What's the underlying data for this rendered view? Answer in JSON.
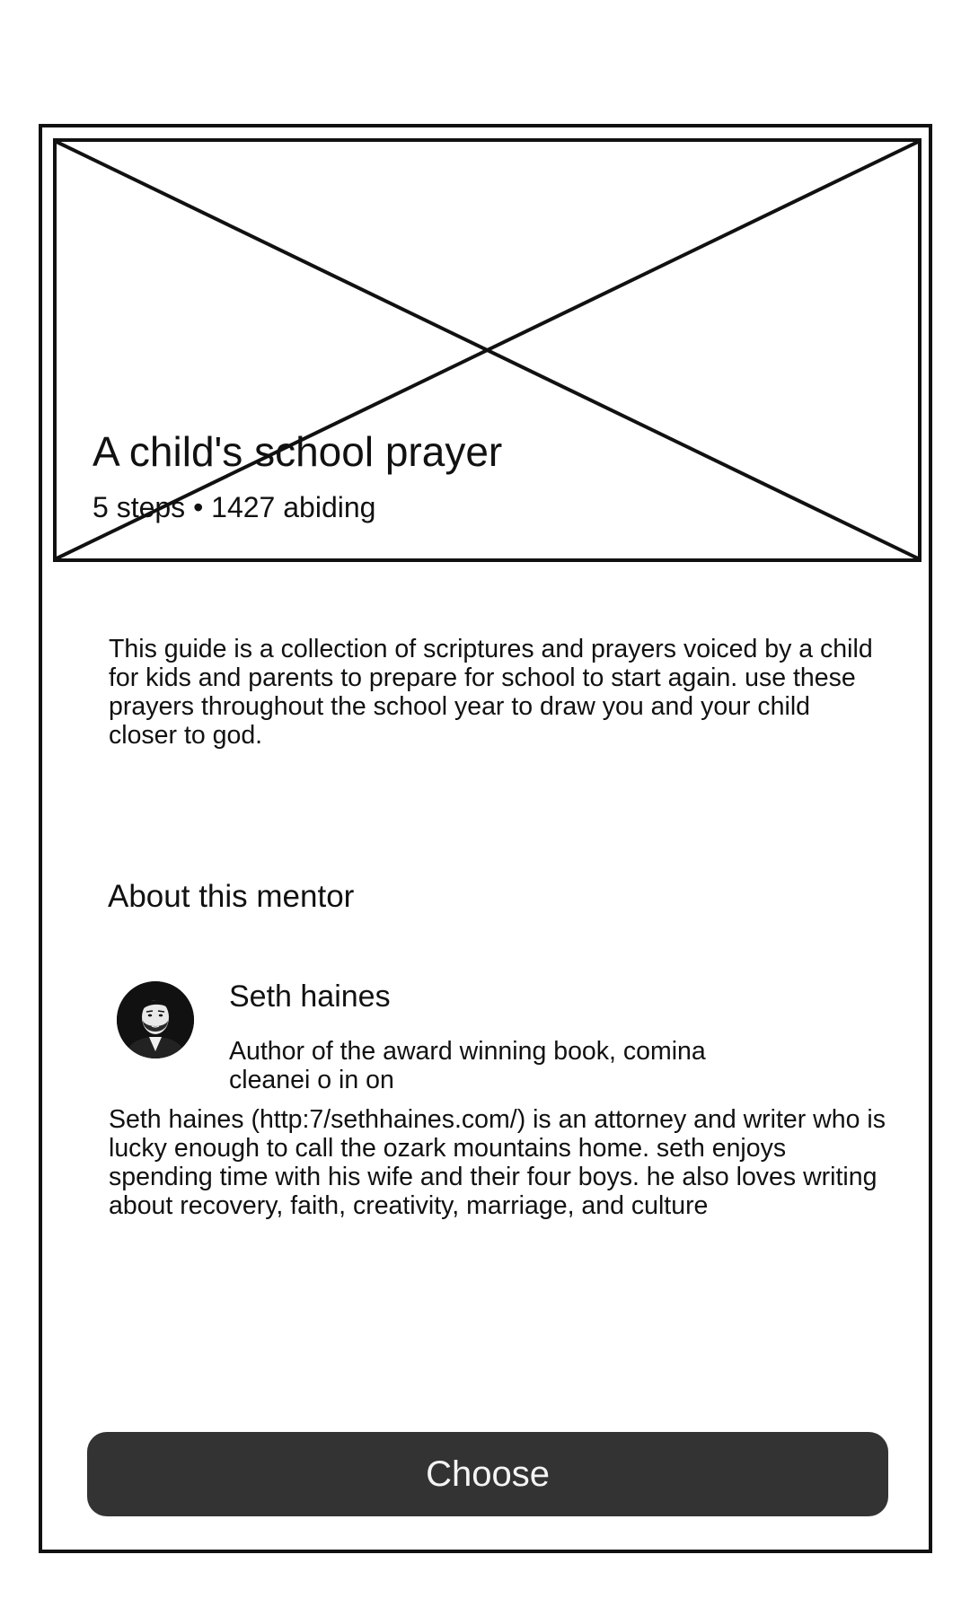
{
  "guide": {
    "title": "A child's school prayer",
    "meta": "5 steps • 1427 abiding",
    "description": "This guide is a collection of scriptures and prayers voiced by a child for kids and parents to prepare for school to start again. use these prayers throughout the school year to draw you and your child closer to god.",
    "cover_image_icon": "image-placeholder-icon"
  },
  "mentor": {
    "section_heading": "About this mentor",
    "avatar_icon": "mentor-avatar",
    "name": "Seth haines",
    "tagline": "Author of the award winning book, comina cleanei o in on",
    "bio": "Seth haines (http:7/sethhaines.com/) is an attorney and writer who is lucky enough to call the ozark mountains home. seth enjoys spending time with his wife and their four boys. he also loves writing about recovery, faith, creativity, marriage, and culture"
  },
  "actions": {
    "choose_label": "Choose"
  },
  "colors": {
    "outline": "#111111",
    "button_background": "#333333",
    "button_text": "#f4f4f4",
    "page_background": "#ffffff"
  }
}
